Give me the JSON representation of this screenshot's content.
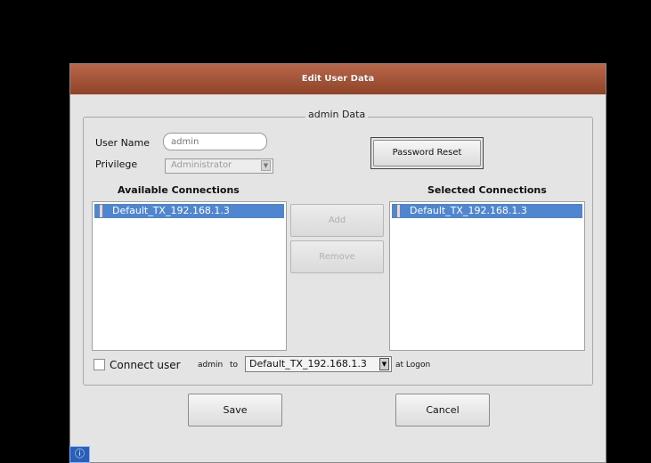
{
  "dialog": {
    "title": "Edit User Data",
    "group_title": "admin Data",
    "user_name_label": "User Name",
    "user_name_placeholder": "admin",
    "privilege_label": "Privilege",
    "privilege_value": "Administrator",
    "password_reset_label": "Password Reset",
    "available_header": "Available Connections",
    "selected_header": "Selected Connections",
    "available_items": [
      "Default_TX_192.168.1.3"
    ],
    "selected_items": [
      "Default_TX_192.168.1.3"
    ],
    "add_label": "Add",
    "remove_label": "Remove",
    "connect_label": "Connect user",
    "connect_user": "admin",
    "connect_to": "to",
    "connect_value": "Default_TX_192.168.1.3",
    "connect_suffix": "at Logon",
    "save_label": "Save",
    "cancel_label": "Cancel"
  },
  "colors": {
    "titlebar": "#a85536",
    "selection": "#4f86cf",
    "background": "#000000",
    "dialog": "#e4e4e4"
  },
  "icons": {
    "combo_arrow": "chevron-down-icon",
    "bottom": "info-icon"
  }
}
